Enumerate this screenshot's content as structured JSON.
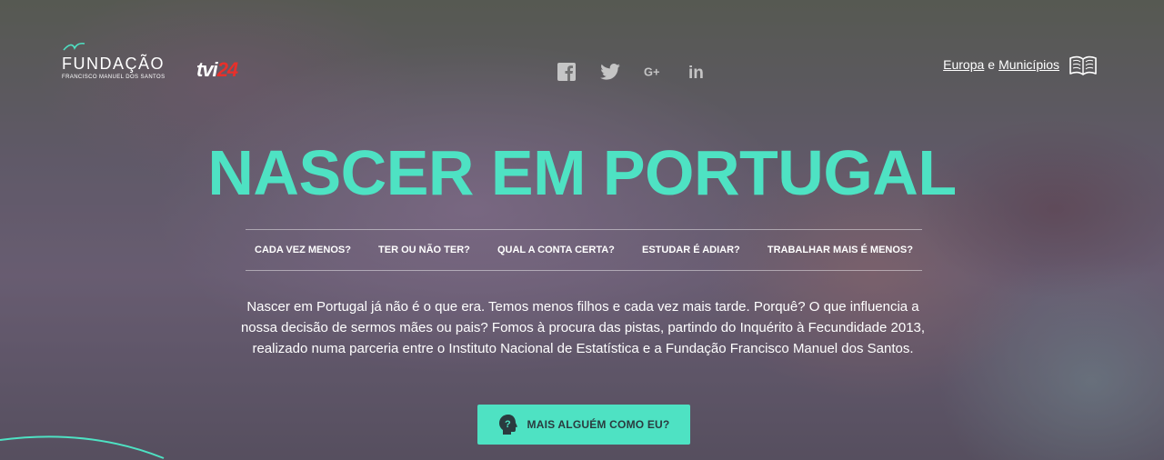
{
  "brand": {
    "fundacao_name": "FUNDAÇÃO",
    "fundacao_sub": "FRANCISCO MANUEL DOS SANTOS",
    "tvi_prefix": "tvi",
    "tvi_suffix": "24"
  },
  "social": [
    {
      "icon": "facebook-icon"
    },
    {
      "icon": "twitter-icon"
    },
    {
      "icon": "google-plus-icon"
    },
    {
      "icon": "linkedin-icon"
    }
  ],
  "header": {
    "europa_label": "Europa",
    "connector": "e",
    "municipios_label": "Municípios",
    "book_icon": "book-icon"
  },
  "hero": {
    "title": "NASCER EM PORTUGAL",
    "intro": "Nascer em Portugal já não é o que era. Temos menos filhos e cada vez mais tarde. Porquê? O que influencia a nossa decisão de sermos mães ou pais? Fomos à procura das pistas, partindo do Inquérito à Fecundidade 2013, realizado numa parceria entre o Instituto Nacional de Estatística e a Fundação Francisco Manuel dos Santos."
  },
  "nav": {
    "items": [
      {
        "label": "CADA VEZ MENOS?"
      },
      {
        "label": "TER OU NÃO TER?"
      },
      {
        "label": "QUAL A CONTA CERTA?"
      },
      {
        "label": "ESTUDAR É ADIAR?"
      },
      {
        "label": "TRABALHAR MAIS É MENOS?"
      }
    ]
  },
  "cta": {
    "label": "MAIS ALGUÉM COMO EU?",
    "icon": "head-question-icon"
  },
  "colors": {
    "accent": "#4ee2c3",
    "tvi_red": "#e8302b"
  }
}
